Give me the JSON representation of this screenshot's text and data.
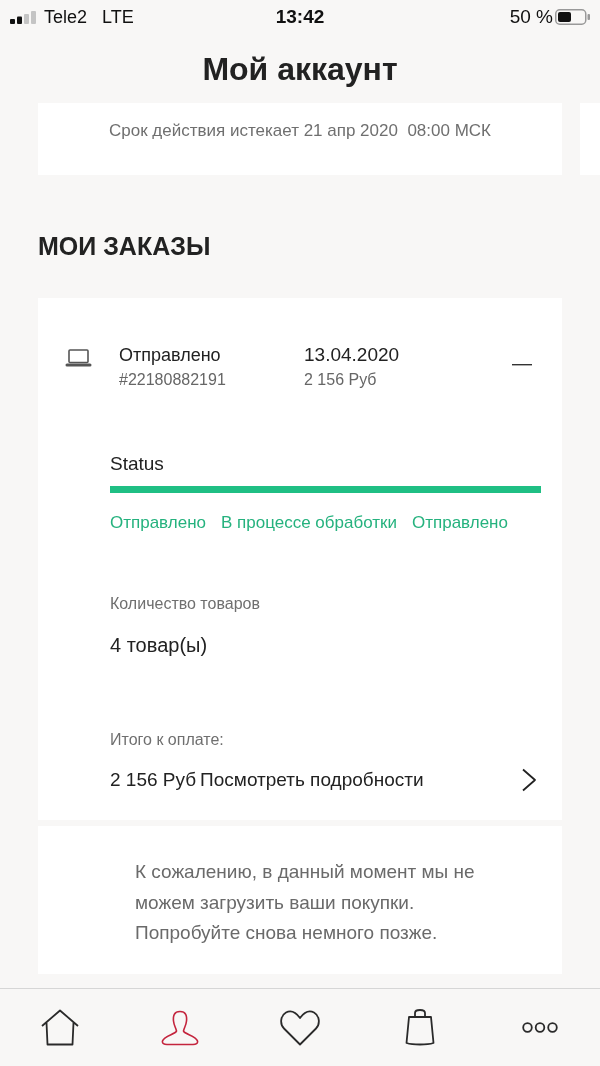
{
  "status_bar": {
    "carrier": "Tele2",
    "network": "LTE",
    "time": "13:42",
    "battery": "50 %"
  },
  "header": {
    "title": "Мой аккаунт"
  },
  "membership_card": {
    "text": "Срок действия истекает 21 апр 2020  08:00 МСК"
  },
  "orders": {
    "heading": "МОИ ЗАКАЗЫ",
    "items": [
      {
        "status": "Отправлено",
        "number": "#22180882191",
        "date": "13.04.2020",
        "price": "2 156 Руб",
        "expanded": true,
        "status_label": "Status",
        "progress": {
          "level": 1
        },
        "steps": [
          {
            "label": "Отправлено",
            "done": true
          },
          {
            "label": "В процессе обработки",
            "done": true
          },
          {
            "label": "Отправлено",
            "done": true
          }
        ],
        "quantity_label": "Количество товаров",
        "quantity": "4 товар(ы)",
        "total_label": "Итого к оплате:",
        "total": "2 156 Руб",
        "details_link": "Посмотреть подробности"
      }
    ]
  },
  "error_card": {
    "text": "К сожалению, в данный момент мы не можем загрузить ваши покупки. Попробуйте снова немного позже."
  },
  "tab_bar": {
    "items": [
      {
        "kind": "home",
        "selected": false
      },
      {
        "kind": "account",
        "selected": true
      },
      {
        "kind": "favorites",
        "selected": false
      },
      {
        "kind": "bag",
        "selected": false
      },
      {
        "kind": "more",
        "selected": false
      }
    ]
  }
}
